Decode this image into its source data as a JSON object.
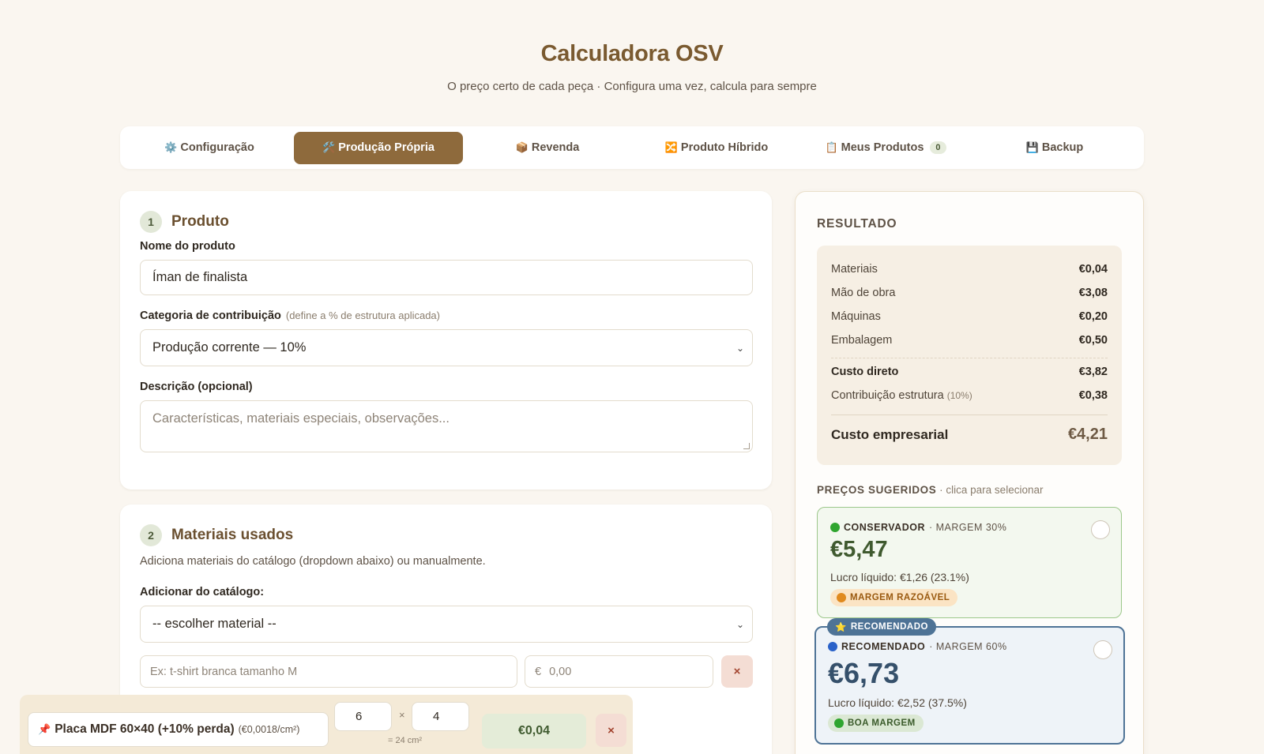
{
  "header": {
    "title": "Calculadora OSV",
    "subtitle": "O preço certo de cada peça · Configura uma vez, calcula para sempre"
  },
  "tabs": [
    {
      "icon": "⚙️",
      "label": "Configuração",
      "active": false
    },
    {
      "icon": "🛠️",
      "label": "Produção Própria",
      "active": true
    },
    {
      "icon": "📦",
      "label": "Revenda",
      "active": false
    },
    {
      "icon": "🔀",
      "label": "Produto Híbrido",
      "active": false
    },
    {
      "icon": "📋",
      "label": "Meus Produtos",
      "count": "0",
      "active": false
    },
    {
      "icon": "💾",
      "label": "Backup",
      "active": false
    }
  ],
  "product": {
    "number": "1",
    "title": "Produto",
    "name_label": "Nome do produto",
    "name_value": "Íman de finalista",
    "category_label": "Categoria de contribuição",
    "category_hint": "(define a % de estrutura aplicada)",
    "category_value": "Produção corrente — 10%",
    "description_label": "Descrição (opcional)",
    "description_placeholder": "Características, materiais especiais, observações..."
  },
  "materials": {
    "number": "2",
    "title": "Materiais usados",
    "intro": "Adiciona materiais do catálogo (dropdown abaixo) ou manualmente.",
    "catalog_label": "Adicionar do catálogo:",
    "catalog_value": "-- escolher material --",
    "manual_name_placeholder": "Ex: t-shirt branca tamanho M",
    "manual_price_prefix": "€",
    "manual_price_placeholder": "0,00",
    "remove_symbol": "×",
    "items": [
      {
        "icon": "📌",
        "name": "Placa MDF 60×40 (+10% perda)",
        "unit_price": "(€0,0018/cm²)",
        "width": "6",
        "times": "×",
        "height": "4",
        "area": "= 24 cm²",
        "total": "€0,04"
      }
    ]
  },
  "result": {
    "title": "RESULTADO",
    "rows": [
      {
        "label": "Materiais",
        "value": "€0,04"
      },
      {
        "label": "Mão de obra",
        "value": "€3,08"
      },
      {
        "label": "Máquinas",
        "value": "€0,20"
      },
      {
        "label": "Embalagem",
        "value": "€0,50"
      }
    ],
    "direct_cost_label": "Custo direto",
    "direct_cost_value": "€3,82",
    "contrib_label": "Contribuição estrutura",
    "contrib_pct": "(10%)",
    "contrib_value": "€0,38",
    "business_cost_label": "Custo empresarial",
    "business_cost_value": "€4,21",
    "suggested_title": "PREÇOS SUGERIDOS",
    "suggested_hint": "· clica para selecionar",
    "options": [
      {
        "name": "CONSERVADOR",
        "margin": "· MARGEM 30%",
        "price": "€5,47",
        "profit": "Lucro líquido: €1,26 (23.1%)",
        "badge": "MARGEM RAZOÁVEL",
        "dot_color": "#2fa52f",
        "badge_dot_color": "#e08a1e"
      },
      {
        "top_badge": "RECOMENDADO",
        "top_badge_icon": "⭐",
        "name": "RECOMENDADO",
        "margin": "· MARGEM 60%",
        "price": "€6,73",
        "profit": "Lucro líquido: €2,52 (37.5%)",
        "badge": "BOA MARGEM",
        "dot_color": "#2a62c9",
        "badge_dot_color": "#2fa52f"
      }
    ]
  },
  "colors": {
    "background": "#faf6f0",
    "accent": "#8e6a3c",
    "title": "#7a5a30",
    "conservative_green": "#3f5a2f",
    "recommended_blue": "#35506b"
  }
}
